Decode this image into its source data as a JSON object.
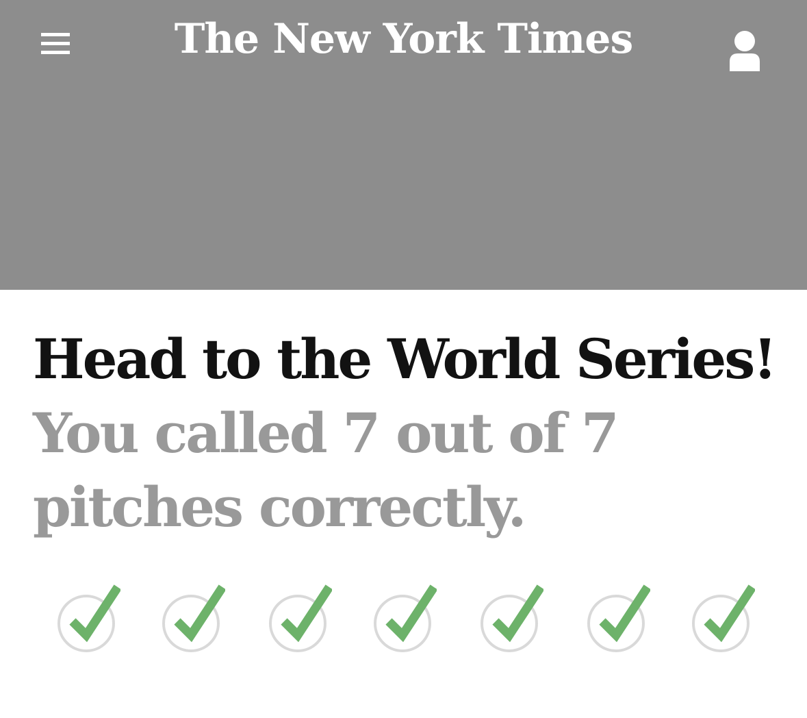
{
  "header": {
    "logo_text": "The New York Times",
    "icons": {
      "menu": "hamburger-menu-icon",
      "account": "user-account-icon"
    },
    "colors": {
      "background": "#8d8d8d",
      "foreground": "#ffffff"
    }
  },
  "result": {
    "title": "Head to the World Series!",
    "summary": "You called 7 out of 7 pitches correctly.",
    "called_correctly": 7,
    "total_pitches": 7
  },
  "pitches": [
    {
      "status": "correct",
      "icon": "check-icon"
    },
    {
      "status": "correct",
      "icon": "check-icon"
    },
    {
      "status": "correct",
      "icon": "check-icon"
    },
    {
      "status": "correct",
      "icon": "check-icon"
    },
    {
      "status": "correct",
      "icon": "check-icon"
    },
    {
      "status": "correct",
      "icon": "check-icon"
    },
    {
      "status": "correct",
      "icon": "check-icon"
    }
  ],
  "colors": {
    "title": "#121212",
    "summary": "#999999",
    "check": "#6db26a",
    "ring": "#d9d9d9"
  }
}
